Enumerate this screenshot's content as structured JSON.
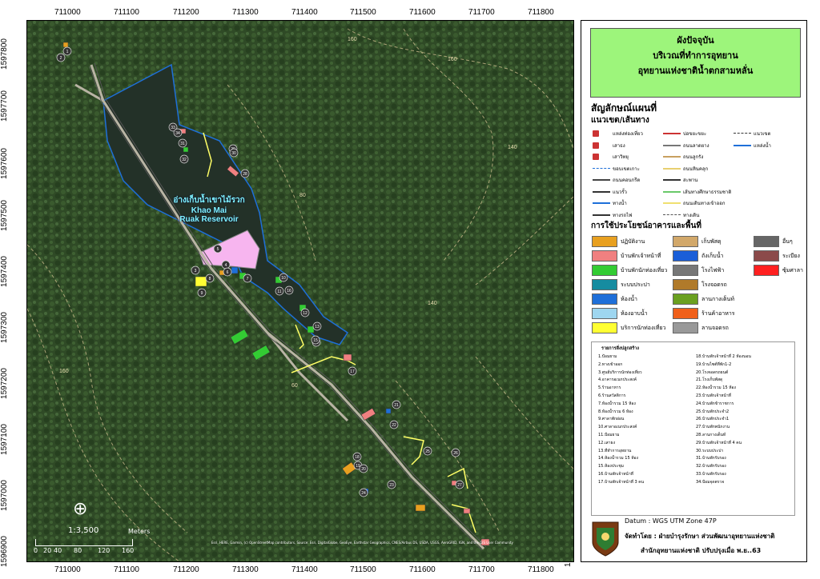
{
  "x_ticks": [
    "711000",
    "711100",
    "711200",
    "711300",
    "711400",
    "711500",
    "711600",
    "711700",
    "711800"
  ],
  "y_ticks": [
    "1597800",
    "1597700",
    "1597600",
    "1597500",
    "1597400",
    "1597300",
    "1597200",
    "1597100",
    "1597000",
    "1596900"
  ],
  "title": {
    "line1": "ผังปัจจุบัน",
    "line2": "บริเวณที่ทำการอุทยาน",
    "line3": "อุทยานแห่งชาติน้ำตกสามหลั่น"
  },
  "legend_heading": "สัญลักษณ์แผนที่",
  "routes_heading": "แนวเขต/เส้นทาง",
  "routes": [
    {
      "label": "แหล่งท่องเที่ยว",
      "color": "#cc3333",
      "style": "point"
    },
    {
      "label": "เสาธง",
      "color": "#cc3333",
      "style": "point"
    },
    {
      "label": "เสาวิทยุ",
      "color": "#cc3333",
      "style": "point"
    },
    {
      "label": "ขอบเขตเกาะ",
      "color": "#1e6fd9",
      "style": "dashed"
    },
    {
      "label": "ถนนคอนกรีต",
      "color": "#444444",
      "style": "solid"
    },
    {
      "label": "แนวรั้ว",
      "color": "#333333",
      "style": "cross"
    },
    {
      "label": "ทางน้ำ",
      "color": "#1e6fd9",
      "style": "solid"
    },
    {
      "label": "ทางรถไฟ",
      "color": "#333333",
      "style": "rail"
    },
    {
      "label": "บ่อขยะขยะ",
      "color": "#cc3333",
      "style": "solid"
    },
    {
      "label": "ถนนลาดยาง",
      "color": "#777777",
      "style": "solid"
    },
    {
      "label": "ถนนลูกรัง",
      "color": "#c8a060",
      "style": "solid"
    },
    {
      "label": "ถนนหินคลุก",
      "color": "#e8d070",
      "style": "solid"
    },
    {
      "label": "สะพาน",
      "color": "#333333",
      "style": "solid"
    },
    {
      "label": "เส้นทางศึกษาธรรมชาติ",
      "color": "#6ac96a",
      "style": "solid"
    },
    {
      "label": "ถนนเดินทางเข้าออก",
      "color": "#f0e070",
      "style": "solid"
    },
    {
      "label": "ทางเดิน",
      "color": "#555555",
      "style": "dashdot"
    },
    {
      "label": "แนวเขต",
      "color": "#333333",
      "style": "dashdot"
    },
    {
      "label": "แหล่งน้ำ",
      "color": "#1e6fd9",
      "style": "solid"
    }
  ],
  "landuse_heading": "การใช้ประโยชน์อาคารและพื้นที่",
  "landuse": [
    {
      "label": "ปฏิบัติงาน",
      "color": "#e8a020"
    },
    {
      "label": "บ้านพักเจ้าหน้าที่",
      "color": "#f08080"
    },
    {
      "label": "บ้านพักนักท่องเที่ยว",
      "color": "#33cc33"
    },
    {
      "label": "ระบบประปา",
      "color": "#168ca0"
    },
    {
      "label": "ห้องน้ำ",
      "color": "#1e6fd9"
    },
    {
      "label": "ห้องอาบน้ำ",
      "color": "#9ed6f0"
    },
    {
      "label": "บริการนักท่องเที่ยว",
      "color": "#ffff33"
    },
    {
      "label": "เก็บพัสดุ",
      "color": "#d2a86a"
    },
    {
      "label": "ถังเก็บน้ำ",
      "color": "#1a5ed8"
    },
    {
      "label": "โรงไฟฟ้า",
      "color": "#777777"
    },
    {
      "label": "โรงจอดรถ",
      "color": "#b07a2a"
    },
    {
      "label": "ลานกางเต็นท์",
      "color": "#6aa020"
    },
    {
      "label": "ร้านค้าอาหาร",
      "color": "#f0601a"
    },
    {
      "label": "ลานจอดรถ",
      "color": "#999999"
    },
    {
      "label": "อื่นๆ",
      "color": "#666666"
    },
    {
      "label": "ระเบียง",
      "color": "#8b4a4a"
    },
    {
      "label": "ซุ้มศาลา",
      "color": "#ff2020"
    }
  ],
  "table_title": "รายการสิ่งปลูกสร้าง",
  "table_left": [
    "1.ป้อมยาม",
    "2.ทางเข้าออก",
    "3.ศูนย์บริการนักท่องเที่ยว",
    "4.อาคารอเนกประสงค์",
    "5.ร้านอาหาร",
    "6.ร้านสวัสดิการ",
    "7.ห้องน้ำรวม 15 ห้อง",
    "8.ห้องน้ำรวม 6 ห้อง",
    "9.ศาลาพักผ่อน",
    "10.ศาลาอเนกประสงค์",
    "11.ป้อมยาม",
    "12.เสาธง",
    "13.ที่ทำการอุทยาน",
    "14.ห้องน้ำรวม 15 ห้อง",
    "15.ห้องประชุม",
    "16.บ้านพักเจ้าหน้าที่",
    "17.บ้านพักเจ้าหน้าที่ 3 คน"
  ],
  "table_right": [
    "18.บ้านพักเจ้าหน้าที่ 2 ห้องนอน",
    "19.บ้านไซต์ที่พัก1-2",
    "20.โรงจอดรถยนต์",
    "21.โรงเก็บพัสดุ",
    "22.ห้องน้ำรวม 15 ห้อง",
    "23.บ้านพักเจ้าหน้าที่",
    "24.บ้านพักข้าราชการ",
    "25.บ้านพักประจำ2",
    "26.บ้านพักประจำ1",
    "27.บ้านพักพนักงาน",
    "28.ลานกางเต็นท์",
    "29.บ้านพักเจ้าหน้าที่ 4 คน",
    "30.ระบบประปา",
    "31.บ้านพักรับรอง",
    "32.บ้านพักรับรอง",
    "33.บ้านพักรับรอง",
    "34.ป้อมจุดตรวจ"
  ],
  "datum": "Datum  : WGS UTM Zone 47P",
  "producer": "จัดทำโดย : ฝ่ายบำรุงรักษา ส่วนพัฒนาอุทยานแห่งชาติ",
  "office": "สำนักอุทยานแห่งชาติ ปรับปรุงเมื่อ พ.ย..63",
  "reservoir_label": {
    "thai": "อ่างเก็บน้ำเขาไม้รวก",
    "en1": "Khao Mai",
    "en2": "Ruak Reservoir"
  },
  "scale": {
    "text": "1:3,500",
    "unit": "Meters",
    "ticks": [
      "0",
      "20",
      "40",
      "80",
      "120",
      "160"
    ]
  },
  "contour_labels": [
    "160",
    "160",
    "140",
    "80",
    "140",
    "60",
    "160"
  ],
  "attribution": "Esri, HERE, Garmin, (c) OpenStreetMap contributors, Source: Esri, DigitalGlobe, GeoEye, Earthstar Geographics, CNES/Airbus DS, USDA, USGS, AeroGRID, IGN, and the GIS User Community",
  "markers": [
    "1",
    "2",
    "3",
    "4",
    "5",
    "6",
    "7",
    "8",
    "9",
    "10",
    "11",
    "12",
    "13",
    "14",
    "15",
    "16",
    "17",
    "18",
    "19",
    "20",
    "21",
    "22",
    "23",
    "24",
    "25",
    "26",
    "27",
    "28",
    "29",
    "30",
    "31",
    "32",
    "33",
    "34"
  ],
  "colors": {
    "title_bg": "#9df57b",
    "forest": "#2e4a25",
    "water": "#26332c",
    "reservoir_outline": "#1e6fd9"
  }
}
